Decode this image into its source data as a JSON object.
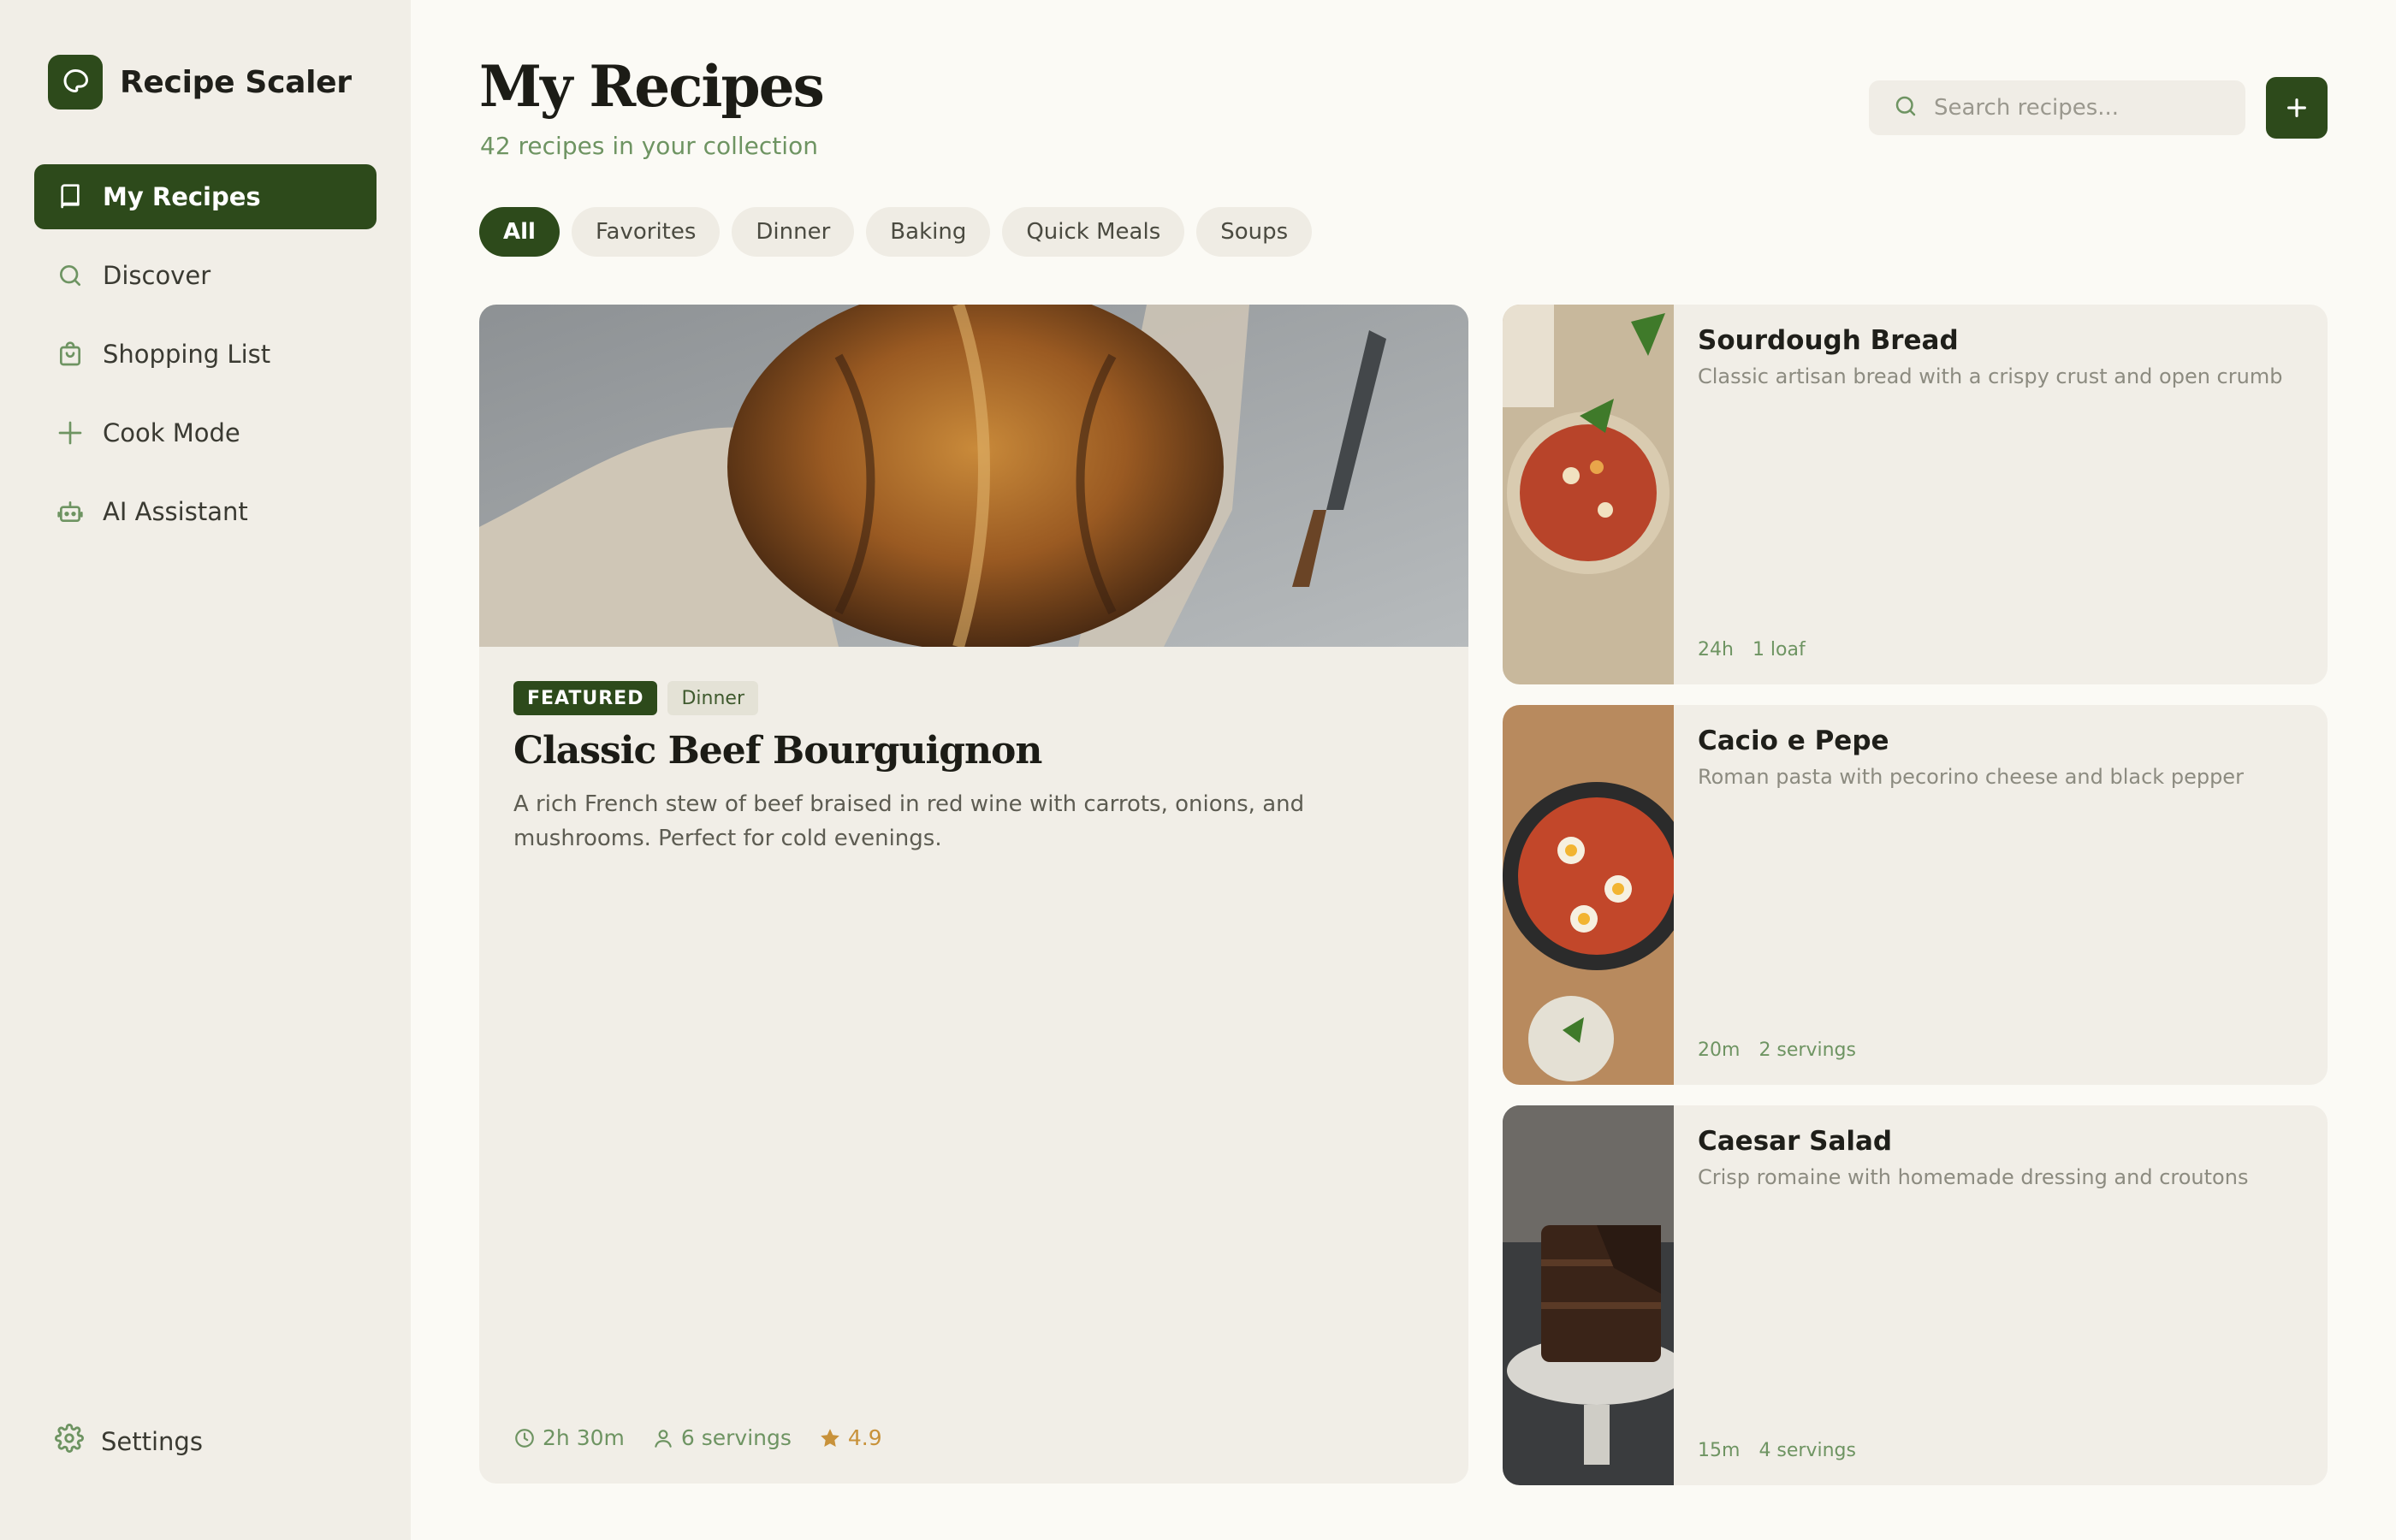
{
  "app": {
    "name": "Recipe Scaler"
  },
  "sidebar": {
    "items": [
      {
        "label": "My Recipes",
        "icon": "book-icon",
        "active": true
      },
      {
        "label": "Discover",
        "icon": "search-icon"
      },
      {
        "label": "Shopping List",
        "icon": "shopping-bag-icon"
      },
      {
        "label": "Cook Mode",
        "icon": "plus-icon"
      },
      {
        "label": "AI Assistant",
        "icon": "robot-icon"
      }
    ],
    "settings_label": "Settings"
  },
  "header": {
    "title": "My Recipes",
    "subtitle": "42 recipes in your collection",
    "search_placeholder": "Search recipes..."
  },
  "filters": [
    "All",
    "Favorites",
    "Dinner",
    "Baking",
    "Quick Meals",
    "Soups"
  ],
  "featured": {
    "badge": "FEATURED",
    "category": "Dinner",
    "title": "Classic Beef Bourguignon",
    "description": "A rich French stew of beef braised in red wine with carrots, onions, and mushrooms. Perfect for cold evenings.",
    "time": "2h 30m",
    "servings": "6 servings",
    "rating": "4.9"
  },
  "recipes": [
    {
      "title": "Sourdough Bread",
      "description": "Classic artisan bread with a crispy crust and open crumb",
      "time": "24h",
      "yield": "1 loaf"
    },
    {
      "title": "Cacio e Pepe",
      "description": "Roman pasta with pecorino cheese and black pepper",
      "time": "20m",
      "yield": "2 servings"
    },
    {
      "title": "Caesar Salad",
      "description": "Crisp romaine with homemade dressing and croutons",
      "time": "15m",
      "yield": "4 servings"
    }
  ],
  "colors": {
    "accent": "#2d4a1b",
    "muted_green": "#6e9462",
    "rating": "#c8923a",
    "surface": "#f1eee7"
  }
}
